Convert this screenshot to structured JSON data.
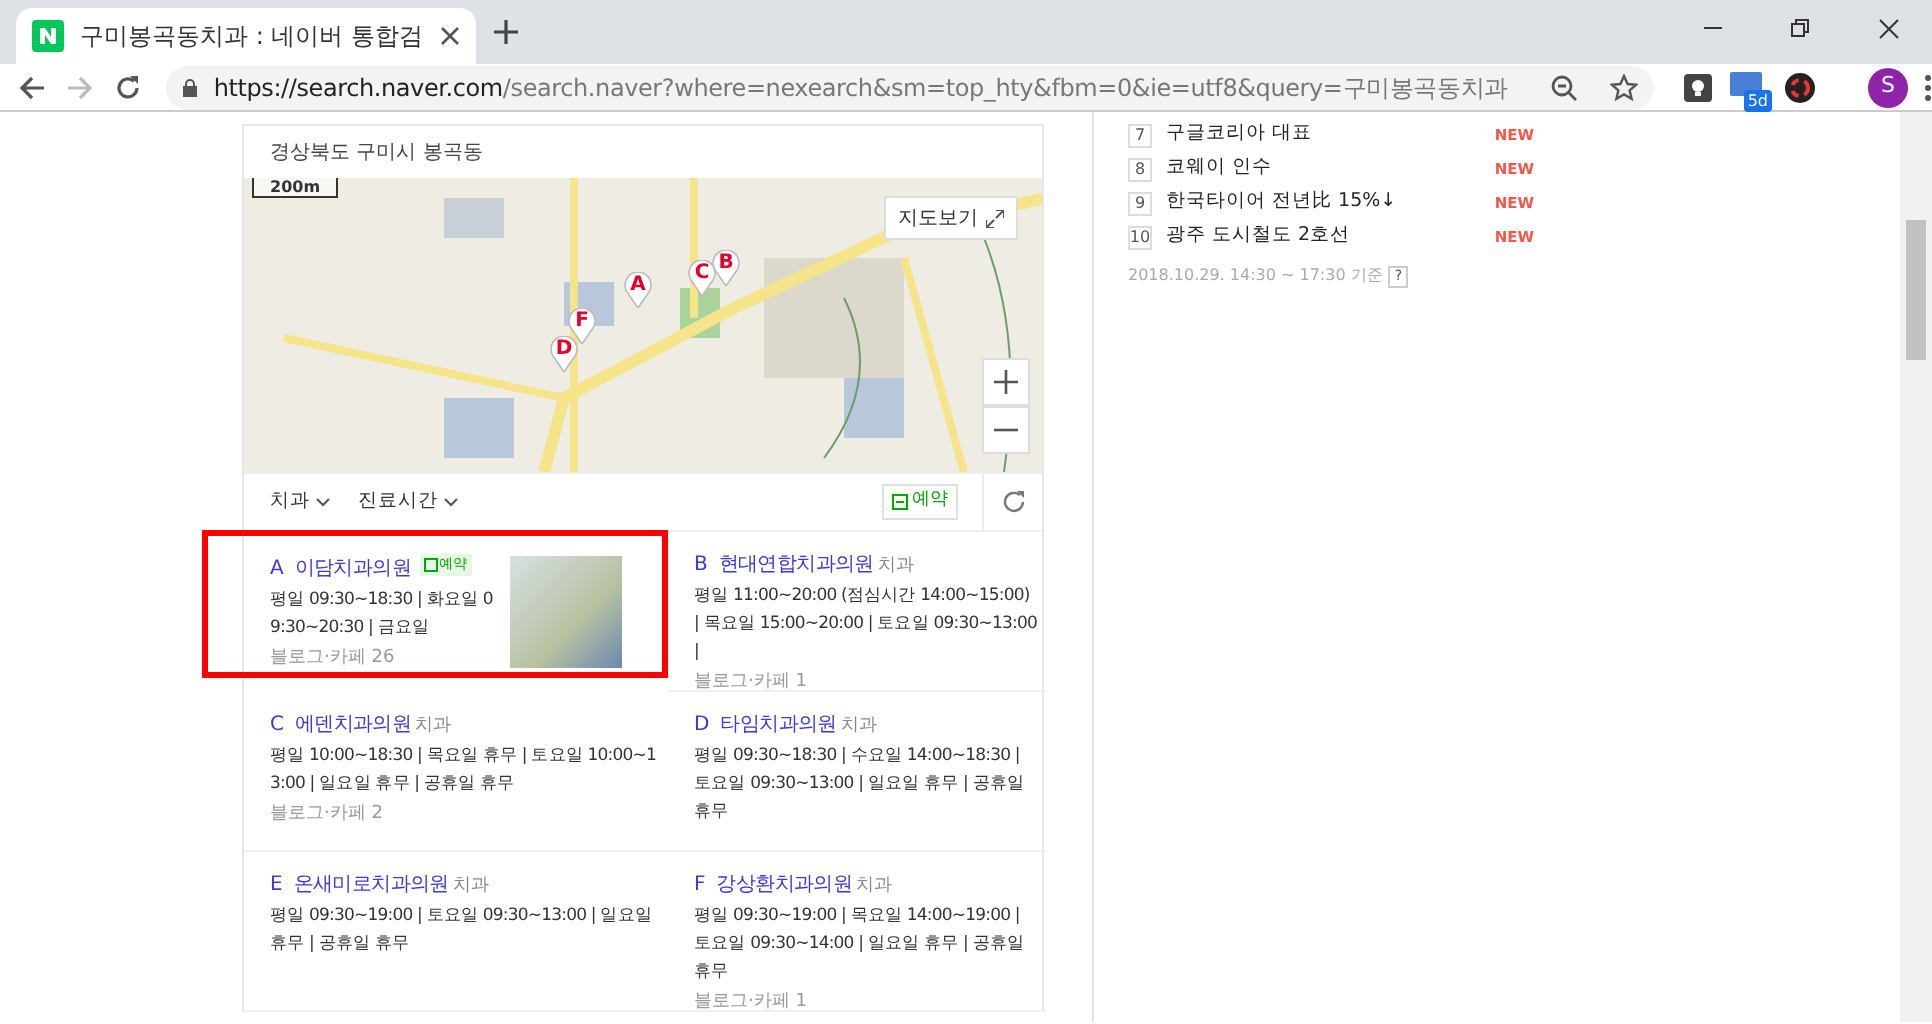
{
  "browser": {
    "tab": {
      "title": "구미봉곡동치과 : 네이버 통합검",
      "selected": true
    },
    "url": {
      "host": "https://search.naver.com",
      "path": "/search.naver?where=nexearch&sm=top_hty&fbm=0&ie=utf8&query=구미봉곡동치과"
    },
    "extension_badge": "5d",
    "profile": "S"
  },
  "map_card": {
    "location": "경상북도 구미시 봉곡동",
    "scale": "200m",
    "map_button": "지도보기",
    "markers": [
      {
        "label": "A"
      },
      {
        "label": "B"
      },
      {
        "label": "C"
      },
      {
        "label": "D"
      },
      {
        "label": "F"
      }
    ],
    "filters": [
      "치과",
      "진료시간"
    ],
    "reserve_button": "예약"
  },
  "clinics": [
    {
      "letter": "A",
      "name": "이담치과의원",
      "booking": true,
      "booking_label": "예약",
      "hours": "평일 09:30~18:30 | 화요일 09:30~20:30 | 금요일",
      "reviews": "블로그·카페 26",
      "photo": true,
      "highlighted": true
    },
    {
      "letter": "B",
      "name": "현대연합치과의원",
      "category": "치과",
      "booking": false,
      "hours": "평일 11:00~20:00 (점심시간 14:00~15:00) | 목요일 15:00~20:00 | 토요일 09:30~13:00 |",
      "reviews": "블로그·카페 1",
      "photo": false,
      "highlighted": false
    },
    {
      "letter": "C",
      "name": "에덴치과의원",
      "category": "치과",
      "booking": false,
      "hours": "평일 10:00~18:30 | 목요일 휴무 | 토요일 10:00~13:00 | 일요일 휴무 | 공휴일 휴무",
      "reviews": "블로그·카페 2",
      "photo": false,
      "highlighted": false
    },
    {
      "letter": "D",
      "name": "타임치과의원",
      "category": "치과",
      "booking": false,
      "hours": "평일 09:30~18:30 | 수요일 14:00~18:30 | 토요일 09:30~13:00 | 일요일 휴무 | 공휴일 휴무",
      "photo": false,
      "highlighted": false
    },
    {
      "letter": "E",
      "name": "온새미로치과의원",
      "category": "치과",
      "booking": false,
      "hours": "평일 09:30~19:00 | 토요일 09:30~13:00 | 일요일 휴무 | 공휴일 휴무",
      "photo": false,
      "highlighted": false
    },
    {
      "letter": "F",
      "name": "강상환치과의원",
      "category": "치과",
      "booking": false,
      "hours": "평일 09:30~19:00 | 목요일 14:00~19:00 | 토요일 09:30~14:00 | 일요일 휴무 | 공휴일 휴무",
      "reviews": "블로그·카페 1",
      "photo": false,
      "highlighted": false
    }
  ],
  "ranking": {
    "items": [
      {
        "rank": "7",
        "title": "구글코리아 대표",
        "badge": "NEW"
      },
      {
        "rank": "8",
        "title": "코웨이 인수",
        "badge": "NEW"
      },
      {
        "rank": "9",
        "title": "한국타이어 전년比 15%↓",
        "badge": "NEW"
      },
      {
        "rank": "10",
        "title": "광주 도시철도 2호선",
        "badge": "NEW"
      }
    ],
    "updated": "2018.10.29. 14:30 ~ 17:30 기준",
    "help": "?"
  }
}
